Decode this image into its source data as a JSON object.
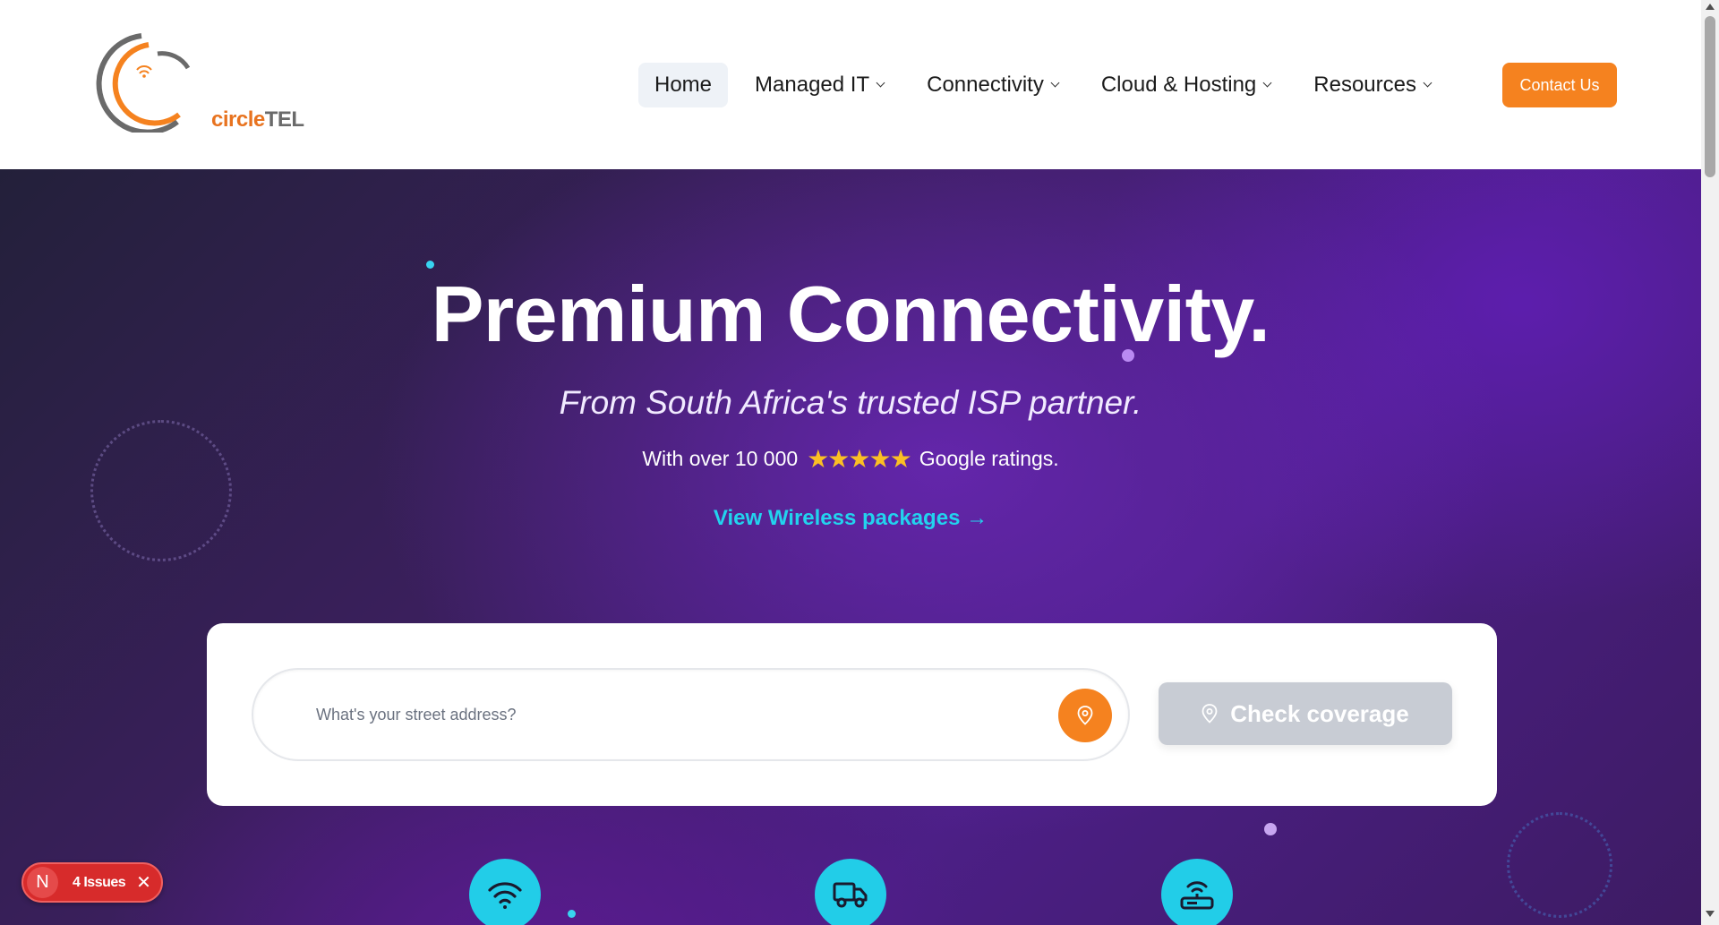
{
  "brand": {
    "logo_text_prefix": "circle",
    "logo_text_suffix": "TEL",
    "colors": {
      "orange": "#f5821f",
      "grey": "#6a6a6a",
      "cyan": "#22d3ee"
    }
  },
  "nav": {
    "items": [
      {
        "label": "Home",
        "active": true,
        "dropdown": false
      },
      {
        "label": "Managed IT",
        "active": false,
        "dropdown": true
      },
      {
        "label": "Connectivity",
        "active": false,
        "dropdown": true
      },
      {
        "label": "Cloud & Hosting",
        "active": false,
        "dropdown": true
      },
      {
        "label": "Resources",
        "active": false,
        "dropdown": true
      }
    ],
    "contact_label": "Contact Us"
  },
  "hero": {
    "title": "Premium Connectivity.",
    "subtitle": "From South Africa's trusted ISP partner.",
    "rating_prefix": "With over 10 000",
    "stars": "★★★★★",
    "rating_suffix": "Google ratings.",
    "link_label": "View Wireless packages →"
  },
  "search": {
    "placeholder": "What's your street address?",
    "value": "",
    "check_label": "Check coverage"
  },
  "features": [
    {
      "icon": "wifi-icon"
    },
    {
      "icon": "truck-icon"
    },
    {
      "icon": "router-icon"
    }
  ],
  "issues_badge": {
    "initial": "N",
    "label": "4 Issues"
  }
}
